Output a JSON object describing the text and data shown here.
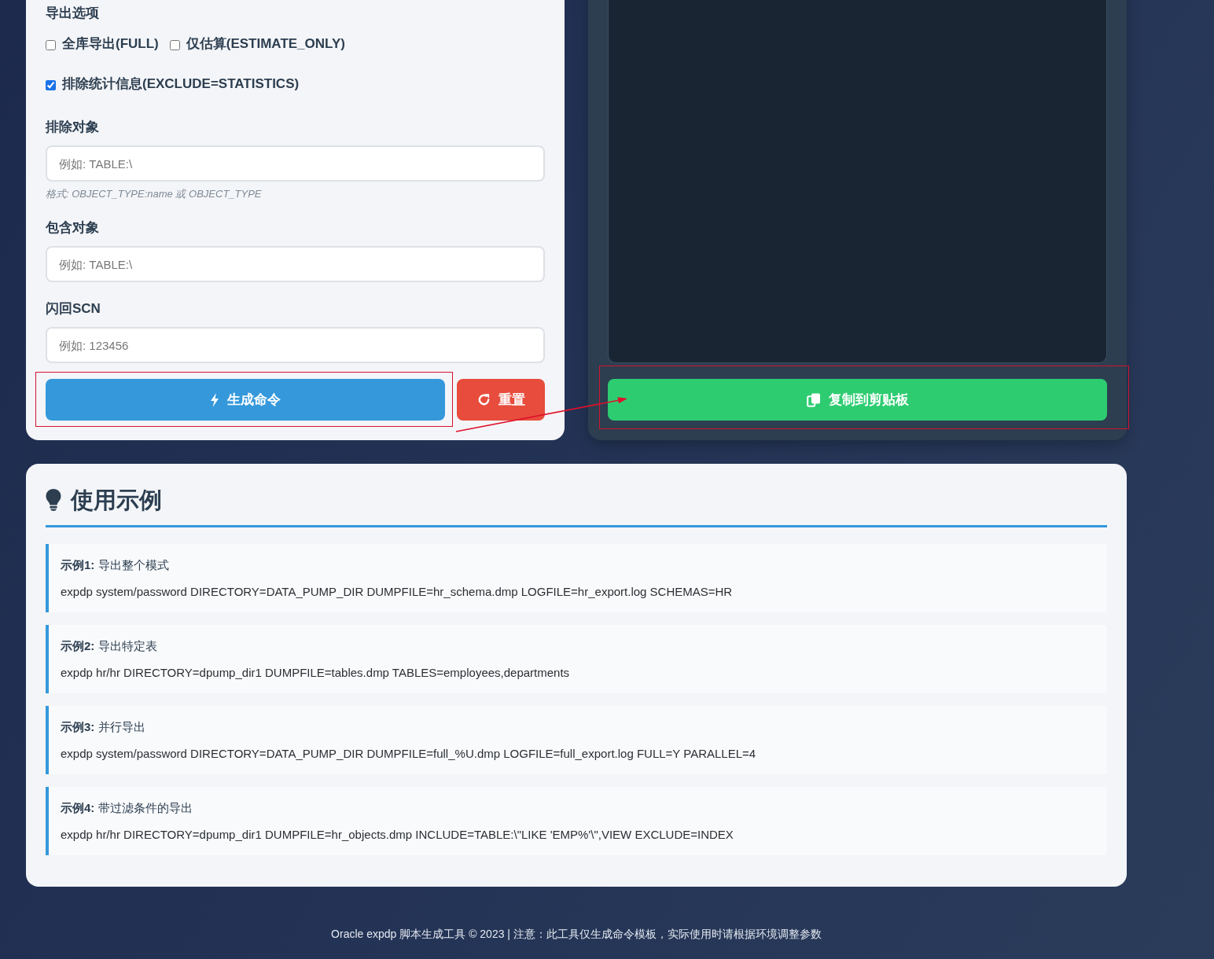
{
  "options_card": {
    "section_label": "导出选项",
    "checkbox_groups": [
      {
        "checkboxes": [
          {
            "label": "全库导出(FULL)",
            "checked": false
          },
          {
            "label": "仅估算(ESTIMATE_ONLY)",
            "checked": false
          }
        ]
      },
      {
        "checkboxes": [
          {
            "label": "排除统计信息(EXCLUDE=STATISTICS)",
            "checked": true
          }
        ]
      }
    ],
    "fields": [
      {
        "label": "排除对象",
        "placeholder": "例如: TABLE:\\",
        "hint": "格式: OBJECT_TYPE:name 或 OBJECT_TYPE"
      },
      {
        "label": "包含对象",
        "placeholder": "例如: TABLE:\\"
      },
      {
        "label": "闪回SCN",
        "placeholder": "例如: 123456"
      }
    ],
    "buttons": [
      {
        "kind": "generate",
        "label": "生成命令",
        "highlighted": true
      },
      {
        "kind": "reset",
        "label": "重置",
        "highlighted": false
      }
    ]
  },
  "output_card": {
    "copy_button": {
      "label": "复制到剪贴板",
      "highlighted": true
    }
  },
  "annotation_arrow": true,
  "examples": {
    "title": "使用示例",
    "items": [
      {
        "title": "**示例1:** 导出整个模式",
        "command": "expdp system/password DIRECTORY=DATA_PUMP_DIR DUMPFILE=hr_schema.dmp LOGFILE=hr_export.log SCHEMAS=HR"
      },
      {
        "title": "**示例2:** 导出特定表",
        "command": "expdp hr/hr DIRECTORY=dpump_dir1 DUMPFILE=tables.dmp TABLES=employees,departments"
      },
      {
        "title": "**示例3:** 并行导出",
        "command": "expdp system/password DIRECTORY=DATA_PUMP_DIR DUMPFILE=full_%U.dmp LOGFILE=full_export.log FULL=Y PARALLEL=4"
      },
      {
        "title": "**示例4:** 带过滤条件的导出",
        "command": "expdp hr/hr DIRECTORY=dpump_dir1 DUMPFILE=hr_objects.dmp INCLUDE=TABLE:\\\"LIKE 'EMP%'\\\",VIEW EXCLUDE=INDEX"
      }
    ]
  },
  "footer": "Oracle expdp 脚本生成工具 © 2023 | 注意：此工具仅生成命令模板，实际使用时请根据环境调整参数"
}
